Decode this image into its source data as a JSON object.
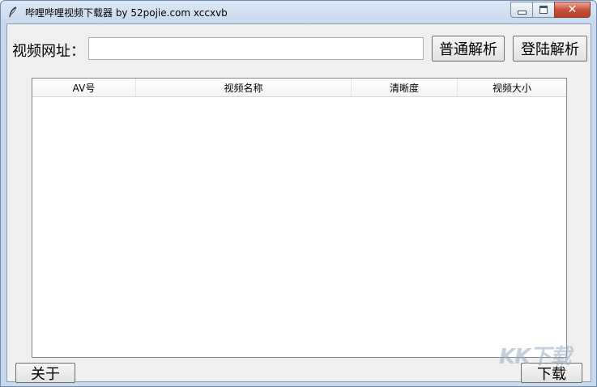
{
  "window": {
    "title": "哔哩哔哩视频下载器 by 52pojie.com xccxvb",
    "icon": "feather-icon",
    "caption_buttons": {
      "minimize_icon": "minimize-icon",
      "maximize_icon": "maximize-icon",
      "close_icon": "close-icon",
      "close_glyph": "✕"
    }
  },
  "form": {
    "url_label": "视频网址：",
    "url_value": "",
    "parse_button": "普通解析",
    "login_parse_button": "登陆解析"
  },
  "table": {
    "columns": [
      "AV号",
      "视频名称",
      "清晰度",
      "视频大小"
    ],
    "rows": []
  },
  "footer": {
    "about_button": "关于",
    "download_button": "下载"
  },
  "watermark": {
    "text": "KK下载"
  },
  "colors": {
    "titlebar": "#c8d9ee",
    "client_bg": "#f0f0f0",
    "close_button": "#c7503b"
  }
}
